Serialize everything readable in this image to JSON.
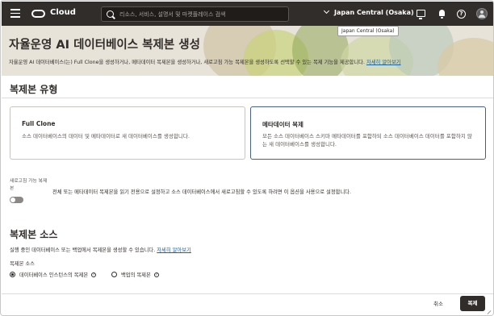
{
  "topbar": {
    "brand": "Cloud",
    "search_placeholder": "리소스, 서비스, 설명서 및 마켓플레이스 검색",
    "region": "Japan Central (Osaka)",
    "region_tooltip": "Japan Central (Osaka)"
  },
  "header": {
    "title": "자율운영 AI 데이터베이스 복제본 생성",
    "description": "자율운영 AI 데이터베이스(는) Full Clone을 생성하거나, 메타데이터 복제본을 생성하거나, 새로고침 가능 복제본을 생성하도록 선택할 수 있는 복제 기능을 제공합니다.",
    "learn_more": "자세히 알아보기"
  },
  "clone_type": {
    "heading": "복제본 유형",
    "options": [
      {
        "title": "Full Clone",
        "description": "소스 데이터베이스의 데이터 및 메타데이터로 새 데이터베이스를 생성합니다."
      },
      {
        "title": "메타데이터 복제",
        "description": "모든 소스 데이터베이스 스키마 메타데이터를 포함하되 소스 데이터베이스 데이터를 포함하지 않는 새 데이터베이스를 생성합니다."
      }
    ],
    "selected_index": 1
  },
  "refreshable": {
    "label": "새로고침 가능 복제본",
    "description": "전체 또는 메타데이터 복제본을 읽기 전용으로 설정하고 소스 데이터베이스에서 새로고침할 수 있도록 하려면 이 옵션을 사용으로 설정합니다.",
    "enabled": false
  },
  "clone_source": {
    "heading": "복제본 소스",
    "description": "실행 중인 데이터베이스 또는 백업에서 복제본을 생성할 수 있습니다.",
    "learn_more": "자세히 알아보기",
    "field_label": "복제본 소스",
    "options": [
      "데이터베이스 인스턴스의 복제본",
      "백업의 복제본"
    ],
    "selected_index": 0
  },
  "footer": {
    "cancel_label": "취소",
    "submit_label": "복제"
  },
  "colors": {
    "topbar": "#312d2a",
    "banner": "#e8e3d9",
    "link": "#1a5f9e",
    "selected_border": "#47607e"
  }
}
